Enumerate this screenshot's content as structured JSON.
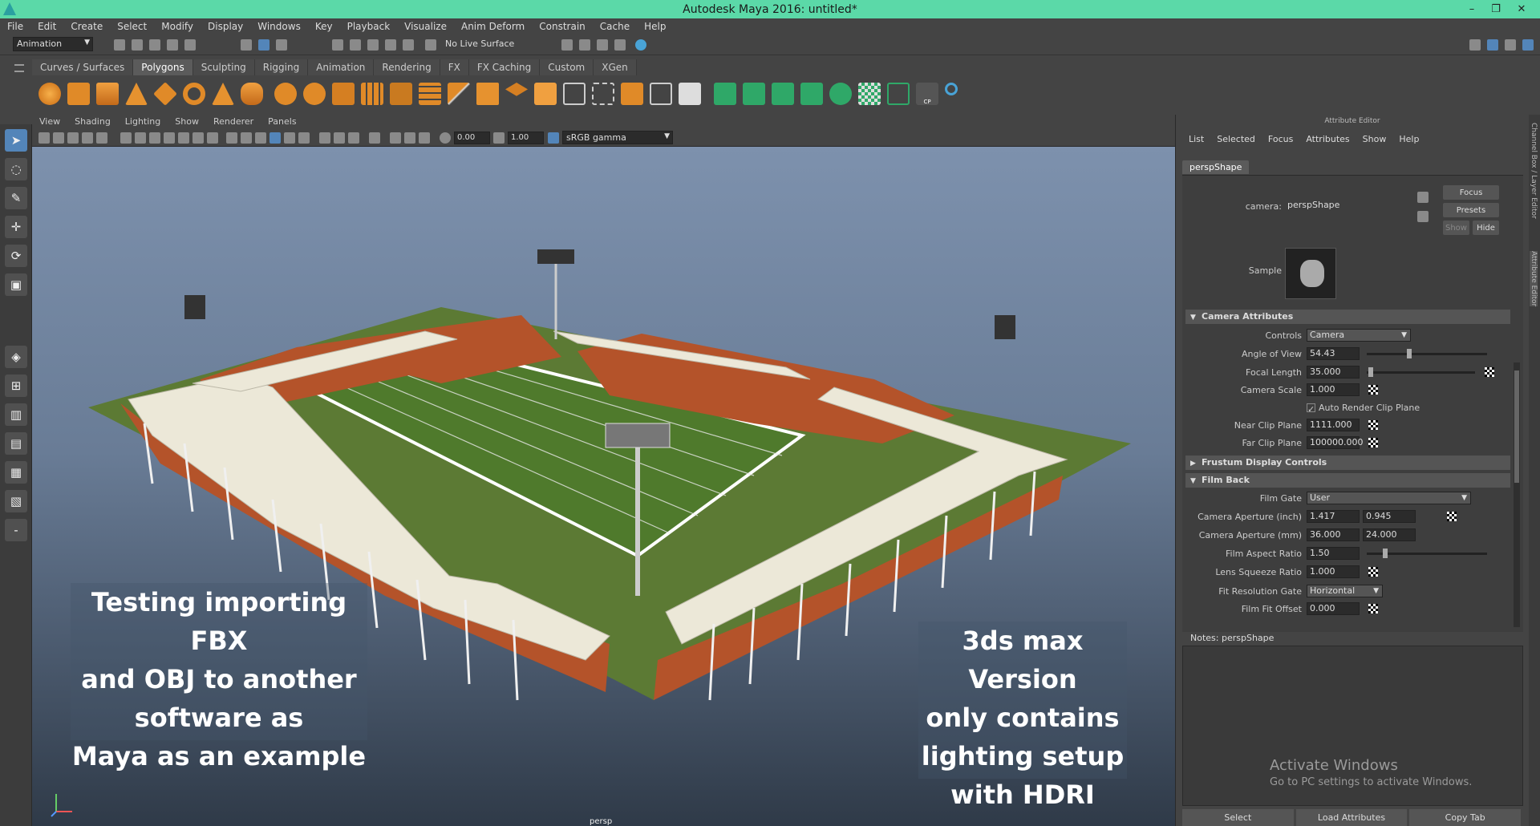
{
  "window": {
    "title": "Autodesk Maya 2016: untitled*",
    "minimize": "–",
    "restore": "❐",
    "close": "✕"
  },
  "menubar": [
    "File",
    "Edit",
    "Create",
    "Select",
    "Modify",
    "Display",
    "Windows",
    "Key",
    "Playback",
    "Visualize",
    "Anim Deform",
    "Constrain",
    "Cache",
    "Help"
  ],
  "statusline": {
    "mode": "Animation",
    "live_surface": "No Live Surface"
  },
  "shelf": {
    "tabs": [
      "Curves / Surfaces",
      "Polygons",
      "Sculpting",
      "Rigging",
      "Animation",
      "Rendering",
      "FX",
      "FX Caching",
      "Custom",
      "XGen"
    ],
    "active_tab": "Polygons",
    "cp_label": "CP"
  },
  "panel": {
    "menu": [
      "View",
      "Shading",
      "Lighting",
      "Show",
      "Renderer",
      "Panels"
    ],
    "exposure": "0.00",
    "gamma": "1.00",
    "color_space": "sRGB gamma",
    "camera_label": "persp"
  },
  "overlay": {
    "left_text": [
      "Testing importing FBX",
      "and OBJ to another",
      "software as",
      "Maya as an example"
    ],
    "right_text": [
      "3ds max Version",
      "only contains",
      "lighting setup",
      "with HDRI"
    ]
  },
  "activate_windows": {
    "title": "Activate Windows",
    "subtitle": "Go to PC settings to activate Windows."
  },
  "attribute_editor": {
    "title": "Attribute Editor",
    "menu": [
      "List",
      "Selected",
      "Focus",
      "Attributes",
      "Show",
      "Help"
    ],
    "tab": "perspShape",
    "camera_label": "camera:",
    "camera_value": "perspShape",
    "focus_btn": "Focus",
    "presets_btn": "Presets",
    "show_btn": "Show",
    "hide_btn": "Hide",
    "sample_label": "Sample",
    "sections": {
      "camera_attributes": "Camera Attributes",
      "frustum": "Frustum Display Controls",
      "film_back": "Film Back"
    },
    "camera_attributes": {
      "controls_label": "Controls",
      "controls_value": "Camera",
      "angle_label": "Angle of View",
      "angle_value": "54.43",
      "focal_label": "Focal Length",
      "focal_value": "35.000",
      "scale_label": "Camera Scale",
      "scale_value": "1.000",
      "auto_clip_label": "Auto Render Clip Plane",
      "near_label": "Near Clip Plane",
      "near_value": "1111.000",
      "far_label": "Far Clip Plane",
      "far_value": "100000.000"
    },
    "film_back": {
      "gate_label": "Film Gate",
      "gate_value": "User",
      "ap_inch_label": "Camera Aperture (inch)",
      "ap_inch_1": "1.417",
      "ap_inch_2": "0.945",
      "ap_mm_label": "Camera Aperture (mm)",
      "ap_mm_1": "36.000",
      "ap_mm_2": "24.000",
      "aspect_label": "Film Aspect Ratio",
      "aspect_value": "1.50",
      "squeeze_label": "Lens Squeeze Ratio",
      "squeeze_value": "1.000",
      "fit_gate_label": "Fit Resolution Gate",
      "fit_gate_value": "Horizontal",
      "fit_offset_label": "Film Fit Offset",
      "fit_offset_value": "0.000"
    },
    "notes_label": "Notes:  perspShape",
    "bottom_buttons": [
      "Select",
      "Load Attributes",
      "Copy Tab"
    ],
    "side_tabs": [
      "Channel Box / Layer Editor",
      "Attribute Editor"
    ]
  },
  "colors": {
    "titlebar": "#5bd9a8",
    "field_green": "#5c7a34",
    "seat_orange": "#b4532a",
    "roof": "#ece8d8",
    "accent_blue": "#5385b9"
  }
}
